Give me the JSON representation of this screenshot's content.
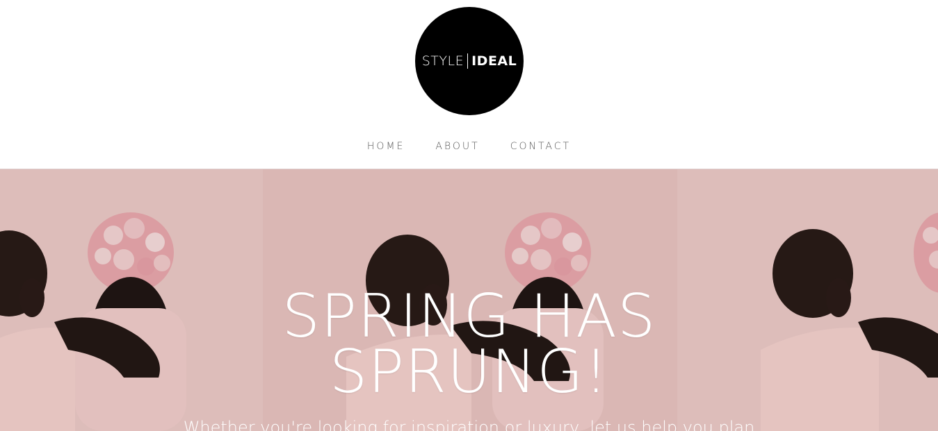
{
  "brand": {
    "logo_left": "STYLE",
    "logo_right": "IDEAL"
  },
  "nav": {
    "items": [
      {
        "label": "HOME"
      },
      {
        "label": "ABOUT"
      },
      {
        "label": "CONTACT"
      }
    ]
  },
  "hero": {
    "title_line1": "SPRING HAS",
    "title_line2": "SPRUNG!",
    "subtitle": "Whether you're looking for inspiration or luxury, let us help you plan"
  },
  "colors": {
    "logo_bg": "#000000",
    "hero_bg": "#e7c7c4",
    "nav_text": "#555555"
  }
}
